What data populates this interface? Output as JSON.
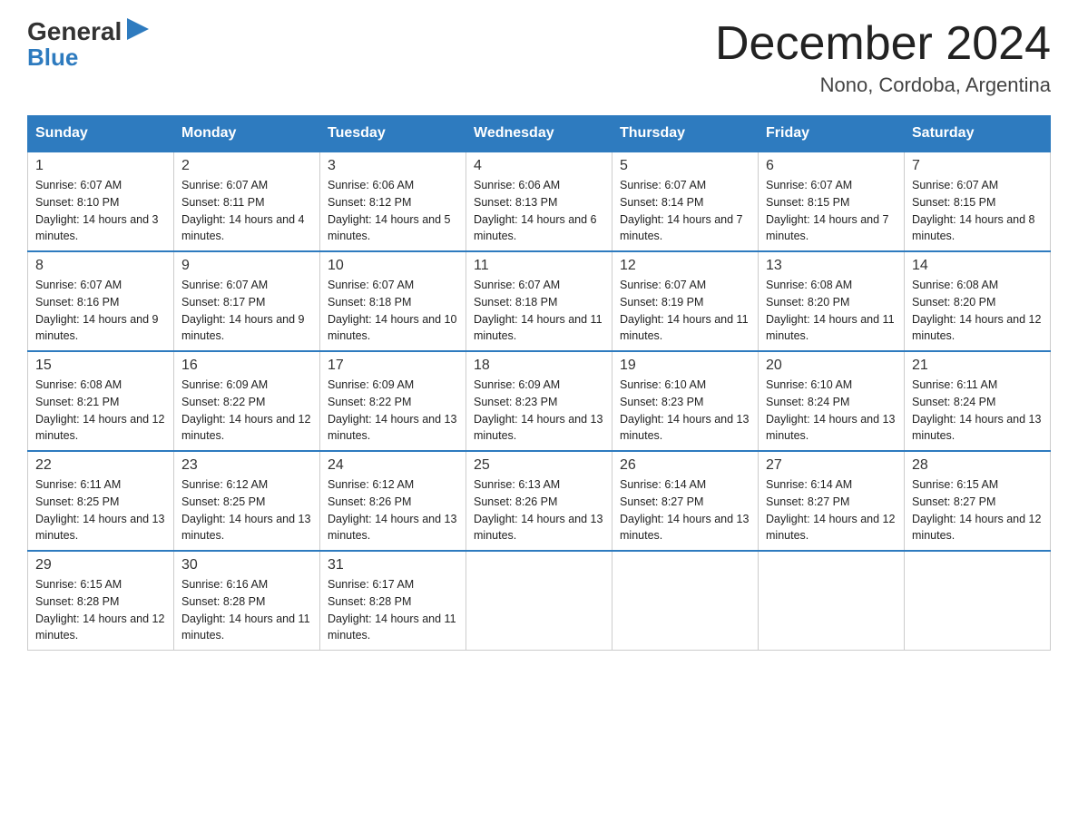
{
  "logo": {
    "text_general": "General",
    "text_blue": "Blue",
    "icon": "▶"
  },
  "header": {
    "month_title": "December 2024",
    "location": "Nono, Cordoba, Argentina"
  },
  "weekdays": [
    "Sunday",
    "Monday",
    "Tuesday",
    "Wednesday",
    "Thursday",
    "Friday",
    "Saturday"
  ],
  "weeks": [
    [
      {
        "day": "1",
        "sunrise": "6:07 AM",
        "sunset": "8:10 PM",
        "daylight": "14 hours and 3 minutes."
      },
      {
        "day": "2",
        "sunrise": "6:07 AM",
        "sunset": "8:11 PM",
        "daylight": "14 hours and 4 minutes."
      },
      {
        "day": "3",
        "sunrise": "6:06 AM",
        "sunset": "8:12 PM",
        "daylight": "14 hours and 5 minutes."
      },
      {
        "day": "4",
        "sunrise": "6:06 AM",
        "sunset": "8:13 PM",
        "daylight": "14 hours and 6 minutes."
      },
      {
        "day": "5",
        "sunrise": "6:07 AM",
        "sunset": "8:14 PM",
        "daylight": "14 hours and 7 minutes."
      },
      {
        "day": "6",
        "sunrise": "6:07 AM",
        "sunset": "8:15 PM",
        "daylight": "14 hours and 7 minutes."
      },
      {
        "day": "7",
        "sunrise": "6:07 AM",
        "sunset": "8:15 PM",
        "daylight": "14 hours and 8 minutes."
      }
    ],
    [
      {
        "day": "8",
        "sunrise": "6:07 AM",
        "sunset": "8:16 PM",
        "daylight": "14 hours and 9 minutes."
      },
      {
        "day": "9",
        "sunrise": "6:07 AM",
        "sunset": "8:17 PM",
        "daylight": "14 hours and 9 minutes."
      },
      {
        "day": "10",
        "sunrise": "6:07 AM",
        "sunset": "8:18 PM",
        "daylight": "14 hours and 10 minutes."
      },
      {
        "day": "11",
        "sunrise": "6:07 AM",
        "sunset": "8:18 PM",
        "daylight": "14 hours and 11 minutes."
      },
      {
        "day": "12",
        "sunrise": "6:07 AM",
        "sunset": "8:19 PM",
        "daylight": "14 hours and 11 minutes."
      },
      {
        "day": "13",
        "sunrise": "6:08 AM",
        "sunset": "8:20 PM",
        "daylight": "14 hours and 11 minutes."
      },
      {
        "day": "14",
        "sunrise": "6:08 AM",
        "sunset": "8:20 PM",
        "daylight": "14 hours and 12 minutes."
      }
    ],
    [
      {
        "day": "15",
        "sunrise": "6:08 AM",
        "sunset": "8:21 PM",
        "daylight": "14 hours and 12 minutes."
      },
      {
        "day": "16",
        "sunrise": "6:09 AM",
        "sunset": "8:22 PM",
        "daylight": "14 hours and 12 minutes."
      },
      {
        "day": "17",
        "sunrise": "6:09 AM",
        "sunset": "8:22 PM",
        "daylight": "14 hours and 13 minutes."
      },
      {
        "day": "18",
        "sunrise": "6:09 AM",
        "sunset": "8:23 PM",
        "daylight": "14 hours and 13 minutes."
      },
      {
        "day": "19",
        "sunrise": "6:10 AM",
        "sunset": "8:23 PM",
        "daylight": "14 hours and 13 minutes."
      },
      {
        "day": "20",
        "sunrise": "6:10 AM",
        "sunset": "8:24 PM",
        "daylight": "14 hours and 13 minutes."
      },
      {
        "day": "21",
        "sunrise": "6:11 AM",
        "sunset": "8:24 PM",
        "daylight": "14 hours and 13 minutes."
      }
    ],
    [
      {
        "day": "22",
        "sunrise": "6:11 AM",
        "sunset": "8:25 PM",
        "daylight": "14 hours and 13 minutes."
      },
      {
        "day": "23",
        "sunrise": "6:12 AM",
        "sunset": "8:25 PM",
        "daylight": "14 hours and 13 minutes."
      },
      {
        "day": "24",
        "sunrise": "6:12 AM",
        "sunset": "8:26 PM",
        "daylight": "14 hours and 13 minutes."
      },
      {
        "day": "25",
        "sunrise": "6:13 AM",
        "sunset": "8:26 PM",
        "daylight": "14 hours and 13 minutes."
      },
      {
        "day": "26",
        "sunrise": "6:14 AM",
        "sunset": "8:27 PM",
        "daylight": "14 hours and 13 minutes."
      },
      {
        "day": "27",
        "sunrise": "6:14 AM",
        "sunset": "8:27 PM",
        "daylight": "14 hours and 12 minutes."
      },
      {
        "day": "28",
        "sunrise": "6:15 AM",
        "sunset": "8:27 PM",
        "daylight": "14 hours and 12 minutes."
      }
    ],
    [
      {
        "day": "29",
        "sunrise": "6:15 AM",
        "sunset": "8:28 PM",
        "daylight": "14 hours and 12 minutes."
      },
      {
        "day": "30",
        "sunrise": "6:16 AM",
        "sunset": "8:28 PM",
        "daylight": "14 hours and 11 minutes."
      },
      {
        "day": "31",
        "sunrise": "6:17 AM",
        "sunset": "8:28 PM",
        "daylight": "14 hours and 11 minutes."
      },
      null,
      null,
      null,
      null
    ]
  ]
}
